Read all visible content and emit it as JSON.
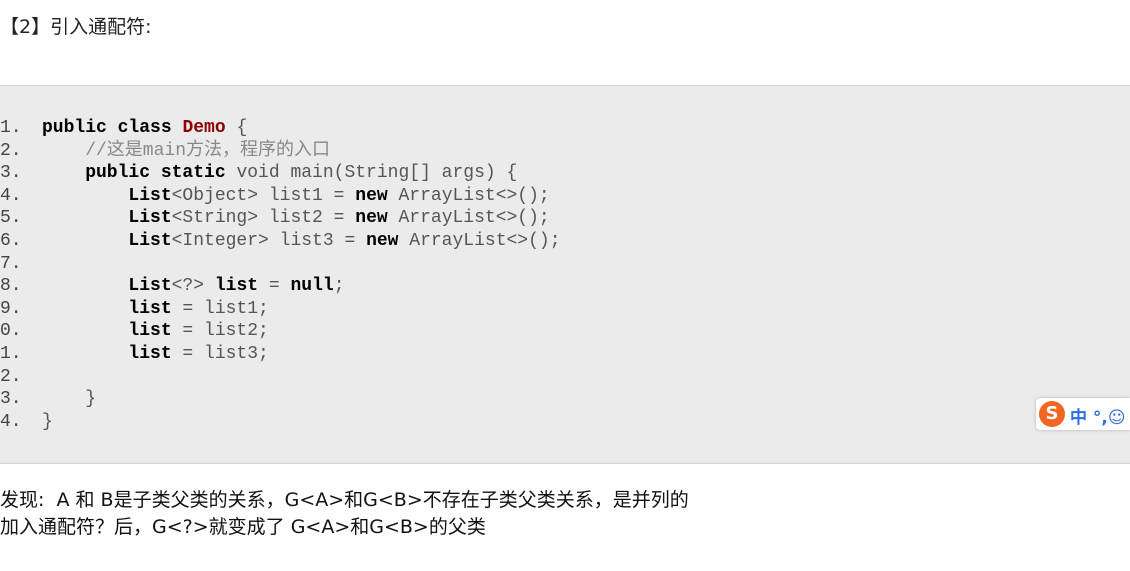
{
  "heading": "【2】引入通配符:",
  "code": {
    "line_numbers": [
      "1.",
      "2.",
      "3.",
      "4.",
      "5.",
      "6.",
      "7.",
      "8.",
      "9.",
      "0.",
      "1.",
      "2.",
      "3.",
      "4."
    ],
    "lines": [
      [
        {
          "t": "public class ",
          "c": "kw"
        },
        {
          "t": "Demo",
          "c": "cls"
        },
        {
          "t": " {",
          "c": "pl"
        }
      ],
      [
        {
          "t": "    //这是main方法，程序的入口",
          "c": "cm"
        }
      ],
      [
        {
          "t": "    public static ",
          "c": "kw"
        },
        {
          "t": "void main(String[] args) {",
          "c": "pl"
        }
      ],
      [
        {
          "t": "        List",
          "c": "kw"
        },
        {
          "t": "<Object> list1 = ",
          "c": "pl"
        },
        {
          "t": "new ",
          "c": "kw"
        },
        {
          "t": "ArrayList<>();",
          "c": "pl"
        }
      ],
      [
        {
          "t": "        List",
          "c": "kw"
        },
        {
          "t": "<String> list2 = ",
          "c": "pl"
        },
        {
          "t": "new ",
          "c": "kw"
        },
        {
          "t": "ArrayList<>();",
          "c": "pl"
        }
      ],
      [
        {
          "t": "        List",
          "c": "kw"
        },
        {
          "t": "<Integer> list3 = ",
          "c": "pl"
        },
        {
          "t": "new ",
          "c": "kw"
        },
        {
          "t": "ArrayList<>();",
          "c": "pl"
        }
      ],
      [],
      [
        {
          "t": "        List",
          "c": "kw"
        },
        {
          "t": "<?> ",
          "c": "pl"
        },
        {
          "t": "list",
          "c": "kw"
        },
        {
          "t": " = ",
          "c": "pl"
        },
        {
          "t": "null",
          "c": "kw"
        },
        {
          "t": ";",
          "c": "pl"
        }
      ],
      [
        {
          "t": "        list",
          "c": "kw"
        },
        {
          "t": " = list1;",
          "c": "pl"
        }
      ],
      [
        {
          "t": "        list",
          "c": "kw"
        },
        {
          "t": " = list2;",
          "c": "pl"
        }
      ],
      [
        {
          "t": "        list",
          "c": "kw"
        },
        {
          "t": " = list3;",
          "c": "pl"
        }
      ],
      [],
      [
        {
          "t": "    }",
          "c": "pl"
        }
      ],
      [
        {
          "t": "}",
          "c": "pl"
        }
      ]
    ]
  },
  "ime": {
    "logo": "S",
    "label": "中 °,☺"
  },
  "notes": [
    "发现:  A 和 B是子类父类的关系，G<A>和G<B>不存在子类父类关系，是并列的",
    "加入通配符？后，G<?>就变成了 G<A>和G<B>的父类"
  ]
}
